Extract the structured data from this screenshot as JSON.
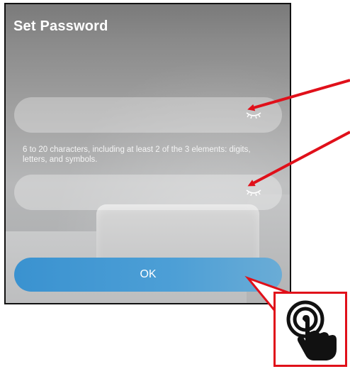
{
  "screen": {
    "title": "Set Password"
  },
  "fields": [
    {
      "value": "",
      "placeholder": "",
      "icon": "eye-closed-icon"
    },
    {
      "value": "",
      "placeholder": "",
      "icon": "eye-closed-icon"
    }
  ],
  "hint": "6 to 20 characters, including at least 2 of the 3 elements: digits, letters, and symbols.",
  "ok_label": "OK",
  "colors": {
    "annotation": "#e0101a",
    "button": "#3a92d0"
  },
  "annotation": {
    "icon": "tap-gesture-icon"
  }
}
